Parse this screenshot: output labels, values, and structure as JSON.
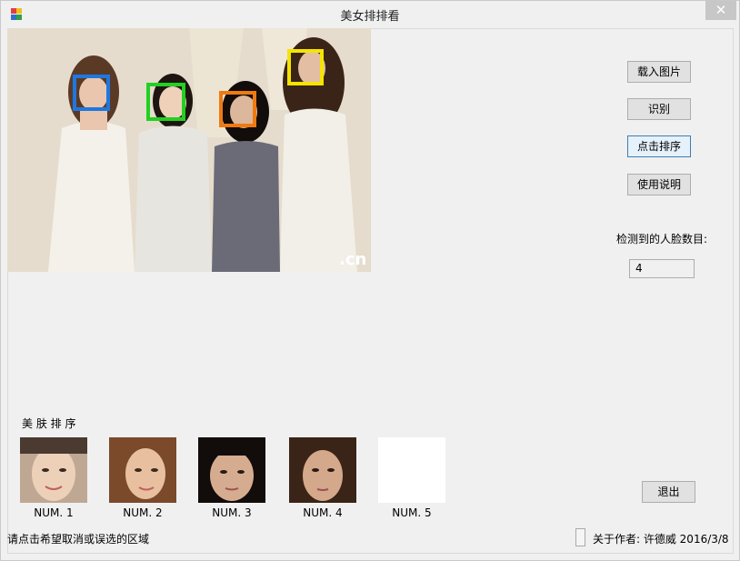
{
  "window": {
    "title": "美女排排看",
    "close_glyph": "✕"
  },
  "buttons": {
    "load_image": "载入图片",
    "recognize": "识别",
    "sort": "点击排序",
    "instructions": "使用说明",
    "exit": "退出"
  },
  "detection": {
    "label": "检测到的人脸数目:",
    "count": "4"
  },
  "photo": {
    "watermark": ".cn"
  },
  "face_box_colors": [
    "#1f77e0",
    "#22d022",
    "#f07a10",
    "#f5e400"
  ],
  "ranking": {
    "label": "美 肤 排 序",
    "items": [
      {
        "label": "NUM. 1"
      },
      {
        "label": "NUM. 2"
      },
      {
        "label": "NUM. 3"
      },
      {
        "label": "NUM. 4"
      },
      {
        "label": "NUM. 5"
      }
    ]
  },
  "status": {
    "hint": "请点击希望取消或误选的区域",
    "author": "关于作者: 许德威 2016/3/8"
  }
}
